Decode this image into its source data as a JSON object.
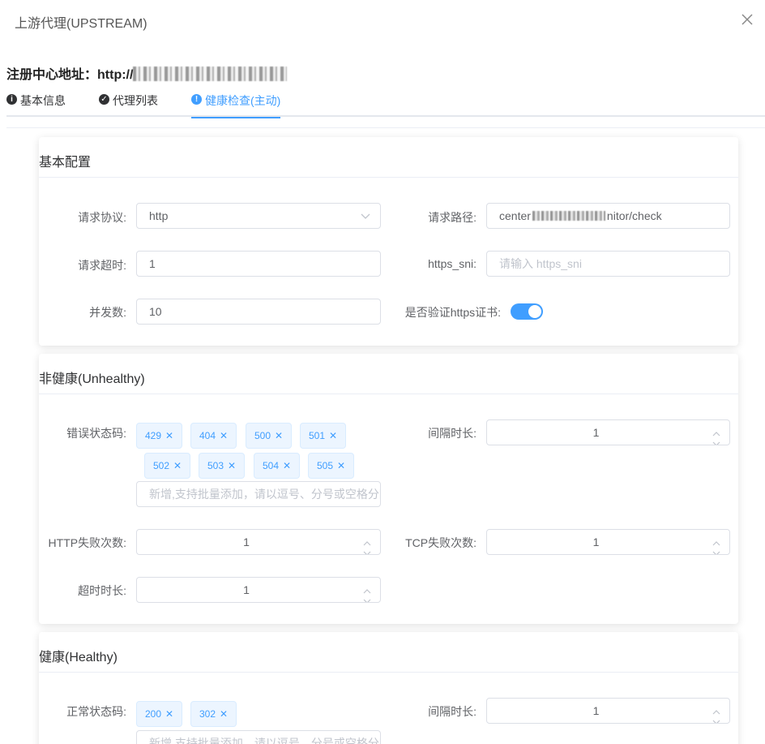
{
  "dialog": {
    "title": "上游代理(UPSTREAM)"
  },
  "registry": {
    "label": "注册中心地址：",
    "url_prefix": "http://"
  },
  "tabs": [
    {
      "label": "基本信息",
      "icon": "info-circle-icon"
    },
    {
      "label": "代理列表",
      "icon": "check-circle-icon"
    },
    {
      "label": "健康检查(主动)",
      "icon": "exclamation-circle-icon"
    }
  ],
  "basic": {
    "title": "基本配置",
    "protocol_label": "请求协议:",
    "protocol_value": "http",
    "path_label": "请求路径:",
    "path_value_start": "center",
    "path_value_end": "nitor/check",
    "timeout_label": "请求超时:",
    "timeout_value": "1",
    "sni_label": "https_sni:",
    "sni_placeholder": "请输入 https_sni",
    "concurrency_label": "并发数:",
    "concurrency_value": "10",
    "verify_label": "是否验证https证书:",
    "verify_on": true
  },
  "unhealthy": {
    "title": "非健康(Unhealthy)",
    "codes_label": "错误状态码:",
    "codes": [
      "429",
      "404",
      "500",
      "501",
      "502",
      "503",
      "504",
      "505"
    ],
    "codes_placeholder": "新增,支持批量添加，请以逗号、分号或空格分隔",
    "interval_label": "间隔时长:",
    "interval_value": "1",
    "http_fail_label": "HTTP失败次数:",
    "http_fail_value": "1",
    "tcp_fail_label": "TCP失败次数:",
    "tcp_fail_value": "1",
    "timeout_label": "超时时长:",
    "timeout_value": "1"
  },
  "healthy": {
    "title": "健康(Healthy)",
    "codes_label": "正常状态码:",
    "codes": [
      "200",
      "302"
    ],
    "codes_placeholder": "新增,支持批量添加，请以逗号、分号或空格分隔",
    "interval_label": "间隔时长:",
    "interval_value": "1"
  },
  "colors": {
    "primary": "#409eff",
    "tag_bg": "#ecf5ff",
    "border": "#dcdfe6"
  }
}
